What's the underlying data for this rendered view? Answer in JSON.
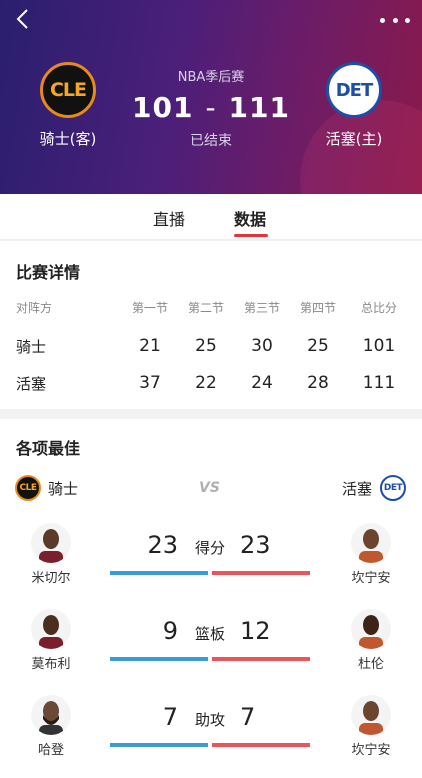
{
  "header": {
    "league": "NBA季后赛",
    "score_away": "101",
    "score_sep": "-",
    "score_home": "111",
    "status": "已结束",
    "away": {
      "name": "骑士(客)",
      "logo_text": "CLE",
      "logo_icon": "cavaliers-logo-icon"
    },
    "home": {
      "name": "活塞(主)",
      "logo_text": "DET",
      "logo_icon": "pistons-logo-icon"
    },
    "colors": {
      "gradient_start": "#2a1f6e",
      "gradient_end": "#8a1a4c"
    }
  },
  "tabs": [
    {
      "label": "直播",
      "active": false
    },
    {
      "label": "数据",
      "active": true
    }
  ],
  "details": {
    "title": "比赛详情",
    "headers": [
      "对阵方",
      "第一节",
      "第二节",
      "第三节",
      "第四节",
      "总比分"
    ],
    "rows": [
      {
        "team": "骑士",
        "q1": "21",
        "q2": "25",
        "q3": "30",
        "q4": "25",
        "total": "101"
      },
      {
        "team": "活塞",
        "q1": "37",
        "q2": "22",
        "q3": "24",
        "q4": "28",
        "total": "111"
      }
    ]
  },
  "leaders": {
    "title": "各项最佳",
    "away_team": "骑士",
    "home_team": "活塞",
    "away_logo_text": "CLE",
    "home_logo_text": "DET",
    "vs": "VS",
    "stats": [
      {
        "label": "得分",
        "left_player": "米切尔",
        "left_value": "23",
        "right_player": "坎宁安",
        "right_value": "23"
      },
      {
        "label": "篮板",
        "left_player": "莫布利",
        "left_value": "9",
        "right_player": "杜伦",
        "right_value": "12"
      },
      {
        "label": "助攻",
        "left_player": "哈登",
        "left_value": "7",
        "right_player": "坎宁安",
        "right_value": "7"
      }
    ],
    "colors": {
      "away_bar": "#3d9ad6",
      "home_bar": "#e8565b"
    }
  }
}
